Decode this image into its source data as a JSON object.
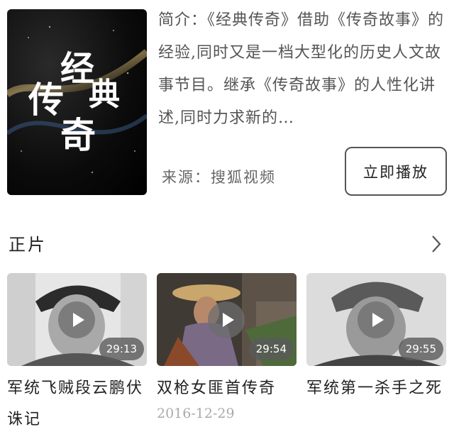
{
  "show": {
    "poster_text": [
      "经",
      "典",
      "传",
      "奇"
    ],
    "description": "简介：《经典传奇》借助《传奇故事》的经验,同时又是一档大型化的历史人文故事节目。继承《传奇故事》的人性化讲述,同时力求新的…",
    "source": "来源：搜狐视频",
    "play_button": "立即播放"
  },
  "section": {
    "title": "正片"
  },
  "videos": [
    {
      "title": "军统飞贼段云鹏伏诛记",
      "duration": "29:13",
      "date": ""
    },
    {
      "title": "双枪女匪首传奇",
      "duration": "29:54",
      "date": "2016-12-29"
    },
    {
      "title": "军统第一杀手之死",
      "duration": "29:55",
      "date": ""
    }
  ]
}
